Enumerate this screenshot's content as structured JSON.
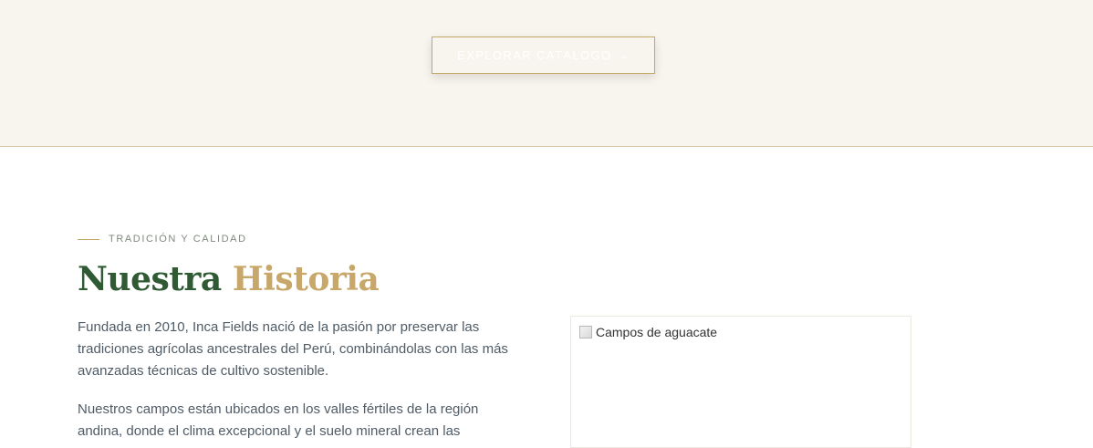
{
  "hero": {
    "cta_label": "EXPLORAR CATÁLOGO →"
  },
  "story": {
    "eyebrow": "TRADICIÓN Y CALIDAD",
    "title_part1": "Nuestra",
    "title_part2": "Historia",
    "paragraph1": "Fundada en 2010, Inca Fields nació de la pasión por preservar las tradiciones agrícolas ancestrales del Perú, combinándolas con las más avanzadas técnicas de cultivo sostenible.",
    "paragraph2": "Nuestros campos están ubicados en los valles fértiles de la región andina, donde el clima excepcional y el suelo mineral crean las",
    "image_alt": "Campos de aguacate"
  },
  "colors": {
    "hero_background": "#f8f4ee",
    "accent_gold": "#c8a86a",
    "brand_green": "#2f5a34",
    "body_text": "#4f5b66"
  }
}
